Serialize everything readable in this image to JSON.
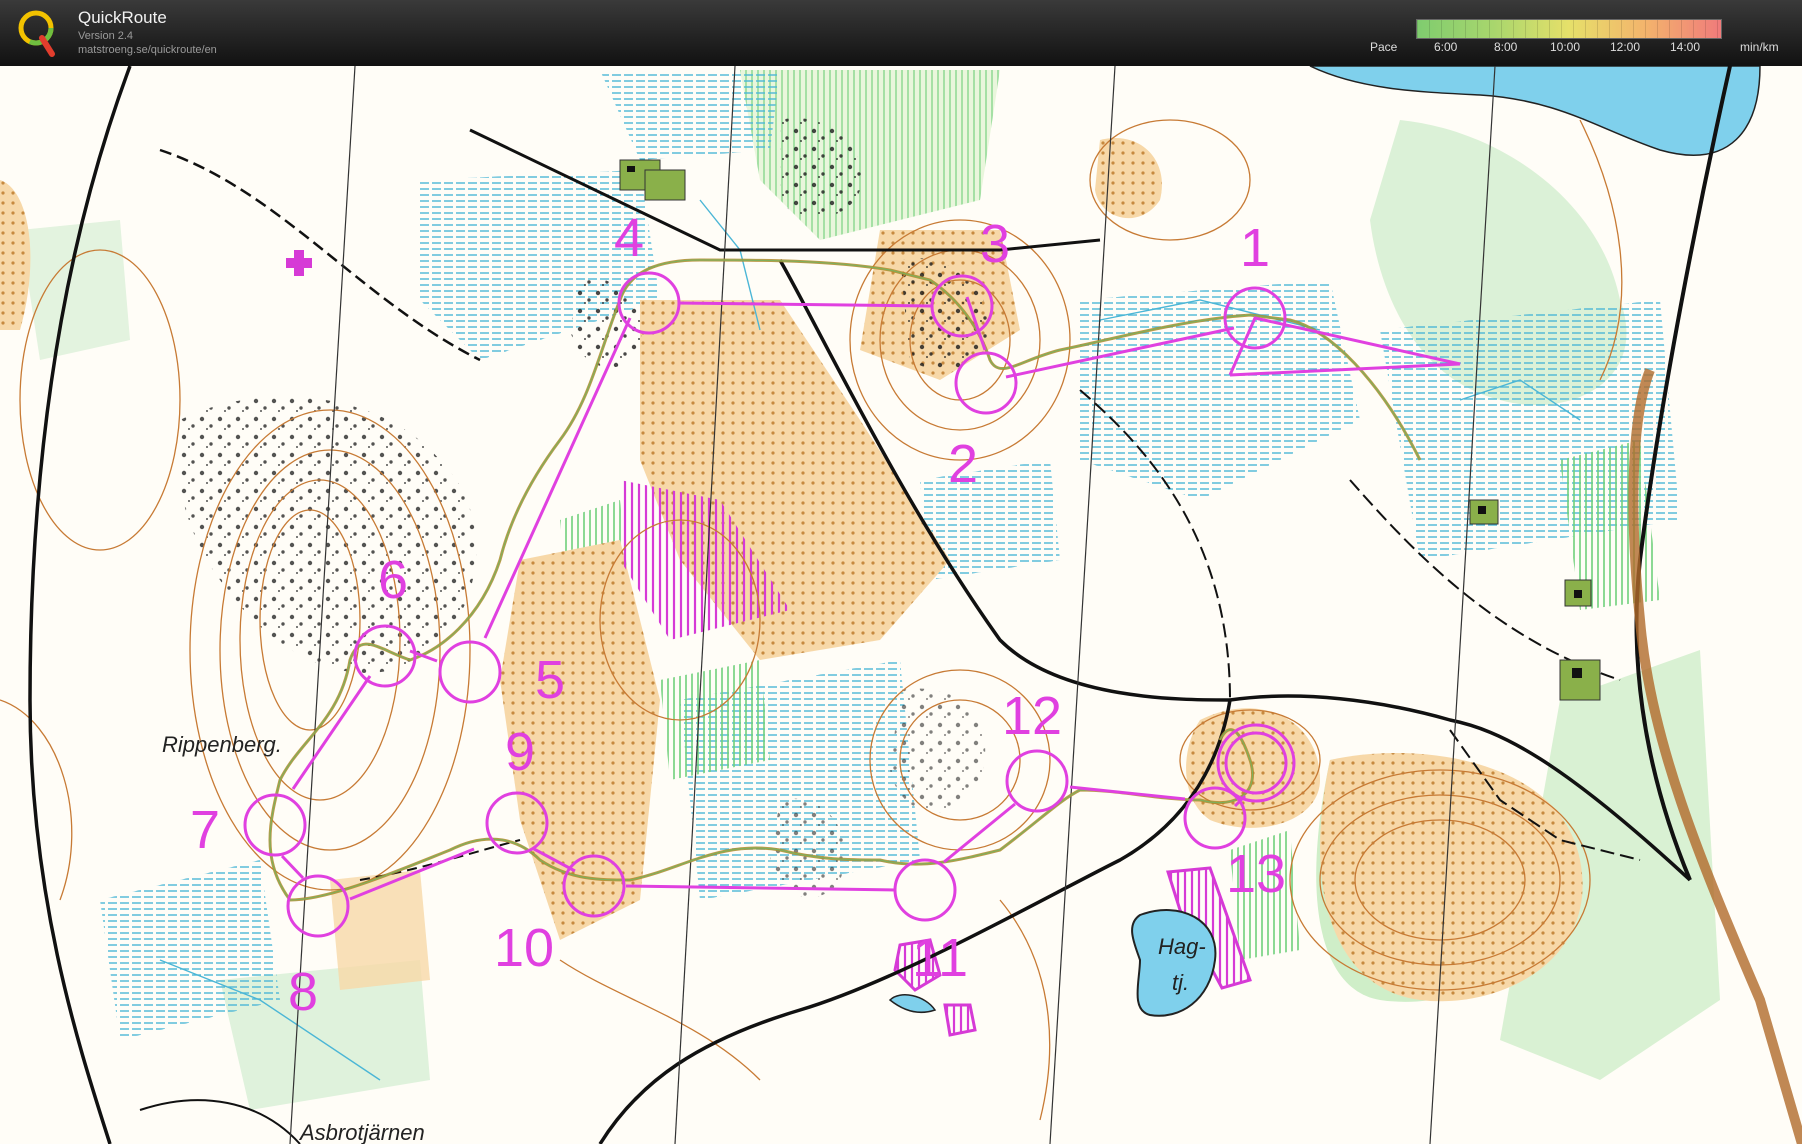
{
  "app": {
    "name": "QuickRoute",
    "version": "Version 2.4",
    "url": "matstroeng.se/quickroute/en"
  },
  "pace_scale": {
    "label": "Pace",
    "ticks": [
      "6:00",
      "8:00",
      "10:00",
      "12:00",
      "14:00"
    ],
    "unit": "min/km",
    "colors": [
      "#7fcc6f",
      "#a8d66d",
      "#e6e06a",
      "#f3b46c",
      "#f07b7b"
    ]
  },
  "map": {
    "place_names": [
      "Rippenberg.",
      "Hag-",
      "tj.",
      "Asbrotjärnen"
    ],
    "course_color": "#e040e0",
    "controls": [
      "1",
      "2",
      "3",
      "4",
      "5",
      "6",
      "7",
      "8",
      "9",
      "10",
      "11",
      "12",
      "13"
    ]
  }
}
